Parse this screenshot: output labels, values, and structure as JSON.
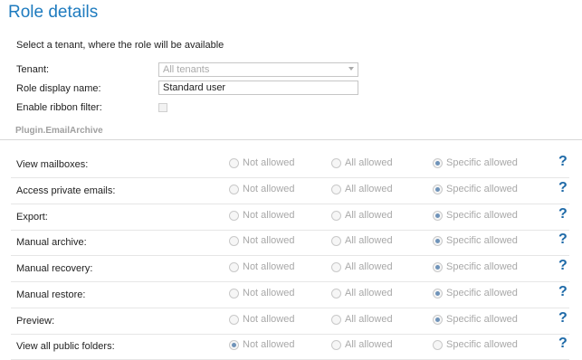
{
  "page_title": "Role details",
  "intro_text": "Select a tenant, where the role will be available",
  "form": {
    "tenant_label": "Tenant:",
    "tenant_value": "All tenants",
    "role_name_label": "Role display name:",
    "role_name_value": "Standard user",
    "ribbon_label": "Enable ribbon filter:"
  },
  "section": {
    "title": "Plugin.EmailArchive"
  },
  "options": {
    "not_allowed": "Not allowed",
    "all_allowed": "All allowed",
    "specific_allowed": "Specific allowed"
  },
  "help_icon": "?",
  "colors": {
    "title_blue": "#1e7bbf",
    "help_blue": "#1e6aa8",
    "selected_radio": "#6f93b9"
  },
  "permissions": [
    {
      "label": "View mailboxes:",
      "selected": "specific_allowed"
    },
    {
      "label": "Access private emails:",
      "selected": "specific_allowed"
    },
    {
      "label": "Export:",
      "selected": "specific_allowed"
    },
    {
      "label": "Manual archive:",
      "selected": "specific_allowed"
    },
    {
      "label": "Manual recovery:",
      "selected": "specific_allowed"
    },
    {
      "label": "Manual restore:",
      "selected": "specific_allowed"
    },
    {
      "label": "Preview:",
      "selected": "specific_allowed"
    },
    {
      "label": "View all public folders:",
      "selected": "not_allowed"
    }
  ]
}
